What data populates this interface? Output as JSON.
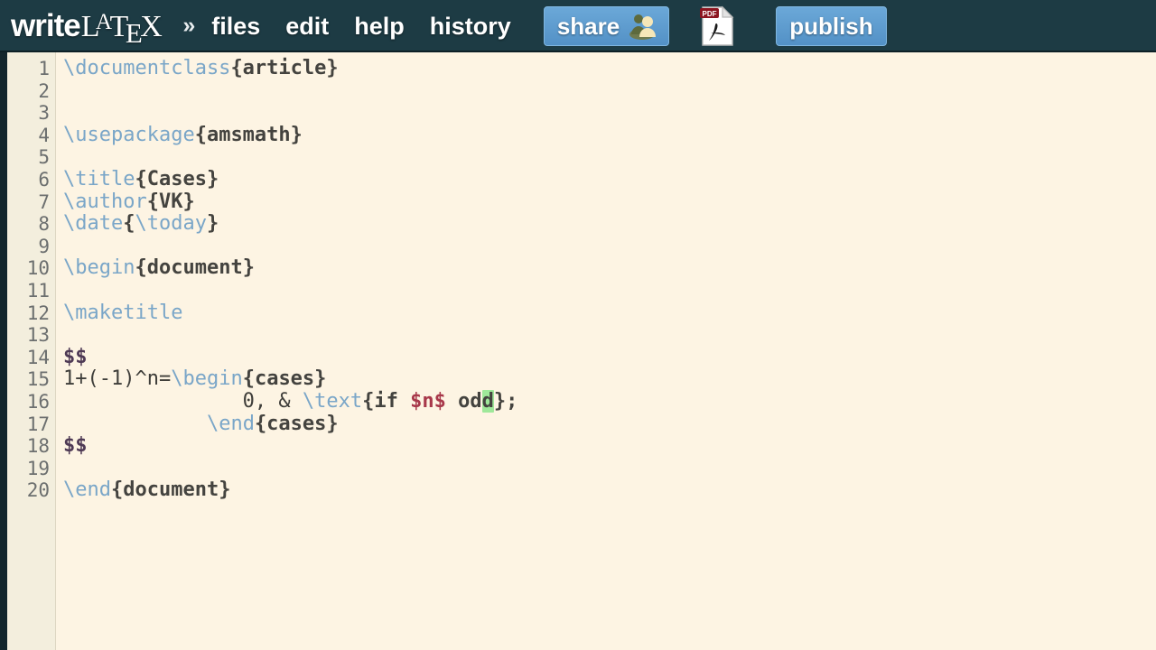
{
  "brand": {
    "write": "write",
    "latex_l": "L",
    "latex_a": "A",
    "latex_t": "T",
    "latex_e": "E",
    "latex_x": "X",
    "full_name": "writeLaTeX"
  },
  "header": {
    "chevron": "»",
    "menu": [
      {
        "id": "files",
        "label": "files"
      },
      {
        "id": "edit",
        "label": "edit"
      },
      {
        "id": "help",
        "label": "help"
      },
      {
        "id": "history",
        "label": "history"
      }
    ],
    "share_label": "share",
    "share_icon": "two-people-icon",
    "pdf_icon": "pdf-document-icon",
    "pdf_icon_label": "PDF",
    "publish_label": "publish",
    "background_color": "#1d3b44",
    "button_color": "#5b9bd5",
    "text_color": "#ffffff"
  },
  "editor": {
    "background_color": "#fdf4e3",
    "gutter_color": "#f3eedd",
    "line_number_color": "#6c6f6f",
    "cursor_highlight_color": "#9fe89a",
    "syntax_colors": {
      "command": "#7aa6c8",
      "argument": "#44433f",
      "plain": "#3f3e3a",
      "display_math_delimiter": "#4f3a55",
      "inline_math": "#a8384a"
    },
    "total_lines": 20,
    "line_numbers": [
      1,
      2,
      3,
      4,
      5,
      6,
      7,
      8,
      9,
      10,
      11,
      12,
      13,
      14,
      15,
      16,
      17,
      18,
      19,
      20
    ],
    "document_text": "\\documentclass{article}\n\n\n\\usepackage{amsmath}\n\n\\title{Cases}\n\\author{VK}\n\\date{\\today}\n\n\\begin{document}\n\n\\maketitle\n\n$$\n1+(-1)^n=\\begin{cases}\n               0, & \\text{if $n$ odd};\n            \\end{cases}\n$$\n\n\\end{document}",
    "lines": [
      {
        "n": 1,
        "tokens": [
          {
            "t": "\\documentclass",
            "c": "cmd"
          },
          {
            "t": "{article}",
            "c": "txt"
          }
        ]
      },
      {
        "n": 2,
        "tokens": []
      },
      {
        "n": 3,
        "tokens": []
      },
      {
        "n": 4,
        "tokens": [
          {
            "t": "\\usepackage",
            "c": "cmd"
          },
          {
            "t": "{amsmath}",
            "c": "txt"
          }
        ]
      },
      {
        "n": 5,
        "tokens": []
      },
      {
        "n": 6,
        "tokens": [
          {
            "t": "\\title",
            "c": "cmd"
          },
          {
            "t": "{Cases}",
            "c": "txt"
          }
        ]
      },
      {
        "n": 7,
        "tokens": [
          {
            "t": "\\author",
            "c": "cmd"
          },
          {
            "t": "{VK}",
            "c": "txt"
          }
        ]
      },
      {
        "n": 8,
        "tokens": [
          {
            "t": "\\date",
            "c": "cmd"
          },
          {
            "t": "{",
            "c": "txt"
          },
          {
            "t": "\\today",
            "c": "cmd"
          },
          {
            "t": "}",
            "c": "txt"
          }
        ]
      },
      {
        "n": 9,
        "tokens": []
      },
      {
        "n": 10,
        "tokens": [
          {
            "t": "\\begin",
            "c": "cmd"
          },
          {
            "t": "{document}",
            "c": "txt"
          }
        ]
      },
      {
        "n": 11,
        "tokens": []
      },
      {
        "n": 12,
        "tokens": [
          {
            "t": "\\maketitle",
            "c": "cmd"
          }
        ]
      },
      {
        "n": 13,
        "tokens": []
      },
      {
        "n": 14,
        "tokens": [
          {
            "t": "$$",
            "c": "mathd"
          }
        ]
      },
      {
        "n": 15,
        "tokens": [
          {
            "t": "1+(-1)^n=",
            "c": "plain"
          },
          {
            "t": "\\begin",
            "c": "cmd"
          },
          {
            "t": "{cases}",
            "c": "txt"
          }
        ]
      },
      {
        "n": 16,
        "tokens": [
          {
            "t": "               0, & ",
            "c": "plain"
          },
          {
            "t": "\\text",
            "c": "cmd"
          },
          {
            "t": "{if ",
            "c": "txt"
          },
          {
            "t": "$n$",
            "c": "inmath"
          },
          {
            "t": " od",
            "c": "txt"
          },
          {
            "t": "d",
            "c": "txt cursor-hl"
          },
          {
            "t": "};",
            "c": "txt"
          }
        ]
      },
      {
        "n": 17,
        "tokens": [
          {
            "t": "            ",
            "c": "plain"
          },
          {
            "t": "\\end",
            "c": "cmd"
          },
          {
            "t": "{cases}",
            "c": "txt"
          }
        ]
      },
      {
        "n": 18,
        "tokens": [
          {
            "t": "$$",
            "c": "mathd"
          }
        ]
      },
      {
        "n": 19,
        "tokens": []
      },
      {
        "n": 20,
        "tokens": [
          {
            "t": "\\end",
            "c": "cmd"
          },
          {
            "t": "{document}",
            "c": "txt"
          }
        ]
      }
    ]
  }
}
